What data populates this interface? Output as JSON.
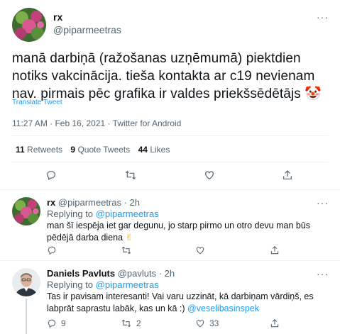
{
  "main": {
    "name": "rx",
    "handle": "@piparmeetras",
    "text": "manā darbiņā (ražošanas uzņēmumā) piektdien notiks vakcinācija. tieša kontakta ar c19 nevienam nav. pirmais pēc grafika ir valdes priekšsēdētājs",
    "emoji": "🤡",
    "translate": "Translate Tweet",
    "meta": "11:27 AM · Feb 16, 2021 · Twitter for Android",
    "stats": {
      "retweets_count": "11",
      "retweets_label": "Retweets",
      "quotes_count": "9",
      "quotes_label": "Quote Tweets",
      "likes_count": "44",
      "likes_label": "Likes"
    }
  },
  "replies": [
    {
      "name": "rx",
      "handle": "@piparmeetras · 2h",
      "replying_prefix": "Replying to",
      "replying_to": "@piparmeetras",
      "text": "man šī iespēja iet gar degunu, jo starp pirmo un otro devu man būs pēdējā darba diena",
      "emoji": "✌",
      "reply_count": "",
      "retweet_count": "",
      "like_count": ""
    },
    {
      "name": "Daniels Pavluts",
      "handle": "@pavluts · 2h",
      "replying_prefix": "Replying to",
      "replying_to": "@piparmeetras",
      "text": "Tas ir pavisam interesanti! Vai varu uzzināt, kā darbiņam vārdiņš, es labprāt saprastu labāk, kas un kā :)",
      "mention": "@veselibasinspek",
      "reply_count": "9",
      "retweet_count": "2",
      "like_count": "33"
    }
  ],
  "icons": {
    "reply": "reply-icon",
    "retweet": "retweet-icon",
    "like": "heart-icon",
    "share": "share-icon",
    "more": "more-icon"
  },
  "colors": {
    "link": "#1d9bf0",
    "muted": "#536471",
    "divider": "#eff3f4"
  }
}
